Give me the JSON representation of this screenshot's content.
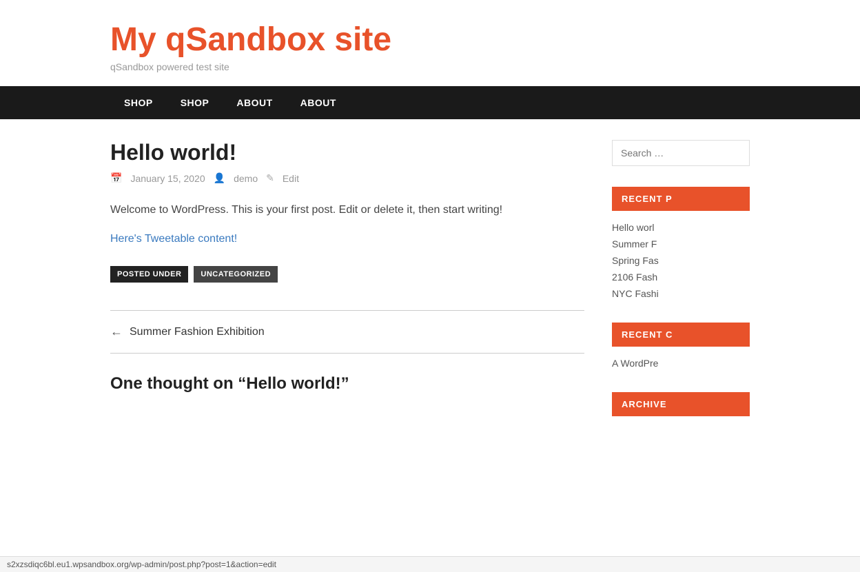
{
  "site": {
    "title": "My qSandbox site",
    "tagline": "qSandbox powered test site"
  },
  "nav": {
    "items": [
      {
        "label": "SHOP"
      },
      {
        "label": "SHOP"
      },
      {
        "label": "ABOUT"
      },
      {
        "label": "ABOUT"
      }
    ]
  },
  "post": {
    "title": "Hello world!",
    "date": "January 15, 2020",
    "author": "demo",
    "edit_label": "Edit",
    "content": "Welcome to WordPress. This is your first post. Edit or delete it, then start writing!",
    "tweetable": "Here's Tweetable content!",
    "tag_label": "POSTED UNDER",
    "tag_value": "UNCATEGORIZED"
  },
  "post_nav": {
    "prev_label": "Summer Fashion Exhibition"
  },
  "comments": {
    "title": "One thought on “Hello world!”",
    "first_comment": "A WordPre"
  },
  "sidebar": {
    "search_placeholder": "Search …",
    "recent_posts_title": "RECENT P",
    "recent_posts": [
      {
        "label": "Hello worl"
      },
      {
        "label": "Summer F"
      },
      {
        "label": "Spring Fas"
      },
      {
        "label": "2106 Fash"
      },
      {
        "label": "NYC Fashi"
      }
    ],
    "recent_comments_title": "RECENT C",
    "recent_comments": [
      {
        "label": "A WordPre"
      }
    ],
    "archive_title": "ARCHIVE"
  },
  "status_bar": {
    "url": "s2xzsdiqc6bl.eu1.wpsandbox.org/wp-admin/post.php?post=1&action=edit"
  }
}
